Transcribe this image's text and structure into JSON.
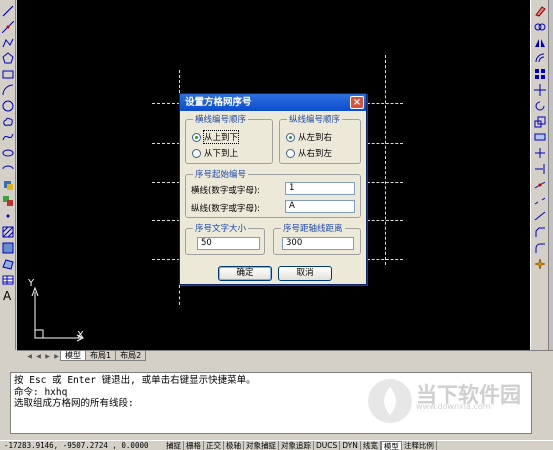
{
  "dialog": {
    "title": "设置方格网序号",
    "h_order_group": "横线编号顺序",
    "h_order_options": [
      "从上到下",
      "从下到上"
    ],
    "v_order_group": "纵线编号顺序",
    "v_order_options": [
      "从左到右",
      "从右到左"
    ],
    "start_group": "序号起始编号",
    "h_start_label": "横线(数字或字母):",
    "h_start_value": "1",
    "v_start_label": "纵线(数字或字母):",
    "v_start_value": "A",
    "text_size_group": "序号文字大小",
    "text_size_value": "50",
    "offset_group": "序号距轴线距离",
    "offset_value": "300",
    "ok_label": "确定",
    "cancel_label": "取消"
  },
  "canvas": {
    "ucs_y": "Y",
    "ucs_x": "X",
    "background": "#000000"
  },
  "layout_tabs": [
    "模型",
    "布局1",
    "布局2"
  ],
  "command": {
    "lines": [
      "按 Esc 或 Enter 键退出, 或单击右键显示快捷菜单。",
      "命令: hxhq",
      "选取组成方格网的所有线段:"
    ]
  },
  "watermark": {
    "title": "当下软件园",
    "url": "www.downxia.com"
  },
  "status_bar": {
    "coords": "-17283.9146, -9507.2724 , 0.0000",
    "buttons": [
      "捕捉",
      "栅格",
      "正交",
      "极轴",
      "对象捕捉",
      "对象追踪",
      "DUCS",
      "DYN",
      "线宽",
      "模型",
      "注释比例"
    ]
  },
  "left_tools": [
    "line-icon",
    "construction-line-icon",
    "polyline-icon",
    "polygon-icon",
    "rectangle-icon",
    "arc-icon",
    "circle-icon",
    "revision-cloud-icon",
    "spline-icon",
    "ellipse-icon",
    "ellipse-arc-icon",
    "insert-block-icon",
    "make-block-icon",
    "point-icon",
    "hatch-icon",
    "gradient-icon",
    "region-icon",
    "table-icon",
    "multiline-text-icon"
  ],
  "right_tools": [
    "erase-icon",
    "copy-icon",
    "mirror-icon",
    "offset-icon",
    "array-icon",
    "move-icon",
    "rotate-icon",
    "scale-icon",
    "stretch-icon",
    "trim-icon",
    "extend-icon",
    "break-at-point-icon",
    "break-icon",
    "join-icon",
    "chamfer-icon",
    "fillet-icon",
    "explode-icon"
  ]
}
